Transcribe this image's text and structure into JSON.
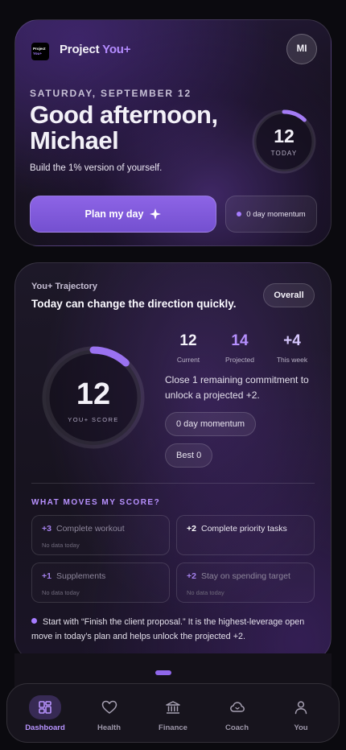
{
  "header": {
    "logo_line1": "Project",
    "logo_line2": "You+",
    "brand_name": "Project ",
    "brand_accent": "You+",
    "avatar_initials": "MI"
  },
  "hero": {
    "date": "SATURDAY, SEPTEMBER 12",
    "greeting": "Good afternoon, Michael",
    "tagline": "Build the 1% version of yourself.",
    "today_score": "12",
    "today_label": "TODAY",
    "today_progress": 0.12,
    "plan_button": "Plan my day",
    "momentum": "0 day momentum"
  },
  "trajectory": {
    "label": "You+ Trajectory",
    "headline": "Today can change the direction quickly.",
    "filter": "Overall",
    "score": "12",
    "score_label": "YOU+ SCORE",
    "score_progress": 0.12,
    "stats": [
      {
        "value": "12",
        "label": "Current"
      },
      {
        "value": "14",
        "label": "Projected"
      },
      {
        "value": "+4",
        "label": "This week"
      }
    ],
    "description": "Close 1 remaining commitment to unlock a projected +2.",
    "momentum_pill": "0 day momentum",
    "best_pill": "Best 0"
  },
  "moves": {
    "title": "WHAT MOVES MY SCORE?",
    "items": [
      {
        "points": "+3",
        "title": "Complete workout",
        "sub": "No data today"
      },
      {
        "points": "+2",
        "title": "Complete priority tasks",
        "sub": ""
      },
      {
        "points": "+1",
        "title": "Supplements",
        "sub": "No data today"
      },
      {
        "points": "+2",
        "title": "Stay on spending target",
        "sub": "No data today"
      }
    ],
    "insight": "Start with “Finish the client proposal.” It is the highest-leverage open move in today’s plan and helps unlock the projected +2."
  },
  "tabs": [
    {
      "label": "Dashboard",
      "icon": "dashboard-icon"
    },
    {
      "label": "Health",
      "icon": "heart-icon"
    },
    {
      "label": "Finance",
      "icon": "bank-icon"
    },
    {
      "label": "Coach",
      "icon": "cloud-icon"
    },
    {
      "label": "You",
      "icon": "user-icon"
    }
  ],
  "colors": {
    "accent": "#8d64e6",
    "accent_text": "#b690ff",
    "background": "#0b0a0f"
  }
}
